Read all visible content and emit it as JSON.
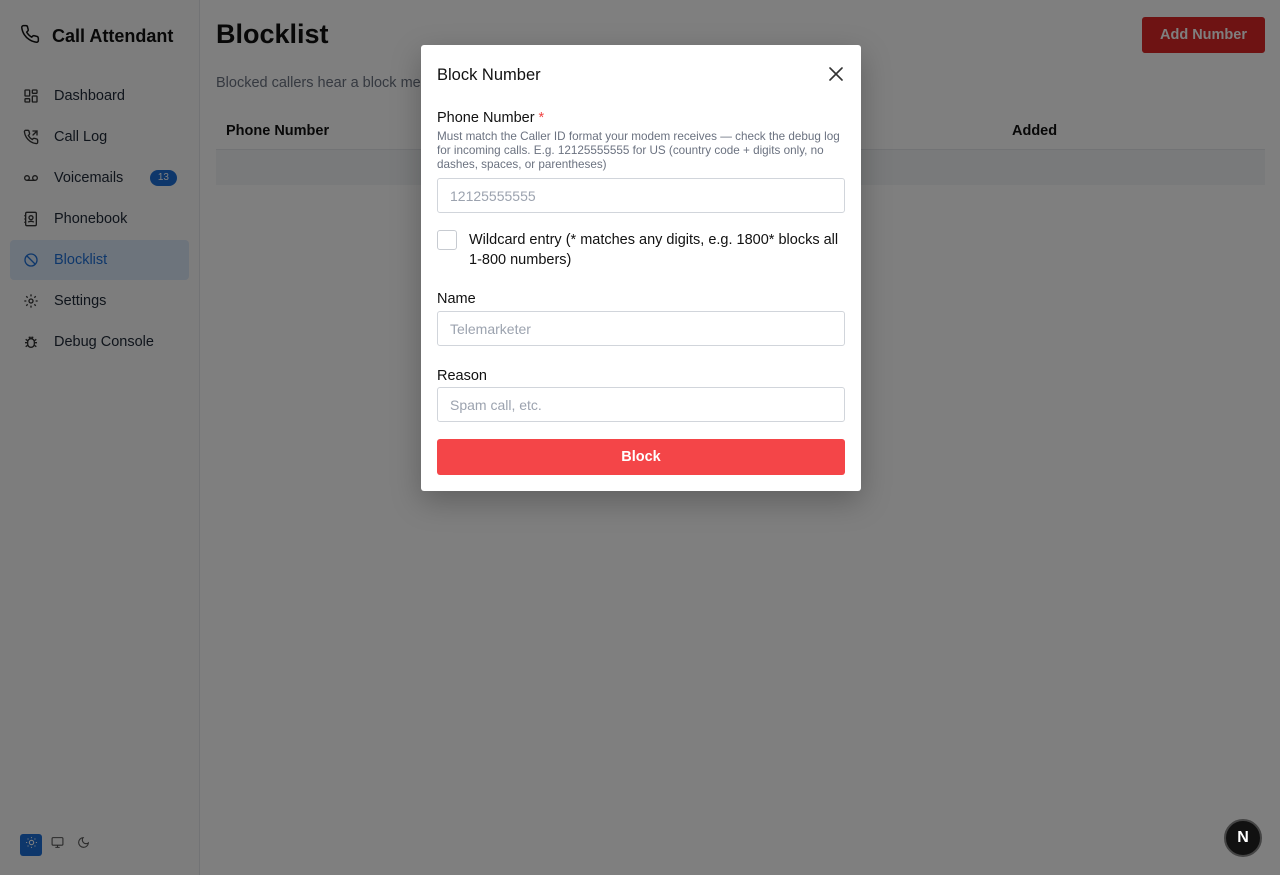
{
  "app": {
    "title": "Call Attendant"
  },
  "sidebar": {
    "items": [
      {
        "label": "Dashboard",
        "icon": "dashboard-icon"
      },
      {
        "label": "Call Log",
        "icon": "phone-log-icon"
      },
      {
        "label": "Voicemails",
        "icon": "voicemail-icon",
        "badge": "13"
      },
      {
        "label": "Phonebook",
        "icon": "contact-book-icon"
      },
      {
        "label": "Blocklist",
        "icon": "block-icon",
        "active": true
      },
      {
        "label": "Settings",
        "icon": "gear-icon"
      },
      {
        "label": "Debug Console",
        "icon": "bug-icon"
      }
    ],
    "theme_options": [
      "light",
      "system",
      "dark"
    ],
    "theme_selected": "light"
  },
  "page": {
    "title": "Blocklist",
    "add_button": "Add Number",
    "subtitle": "Blocked callers hear a block me",
    "table": {
      "columns": [
        "Phone Number",
        "Added"
      ]
    }
  },
  "modal": {
    "title": "Block Number",
    "phone": {
      "label": "Phone Number",
      "required_mark": "*",
      "help": "Must match the Caller ID format your modem receives — check the debug log for incoming calls. E.g. 12125555555 for US (country code + digits only, no dashes, spaces, or parentheses)",
      "placeholder": "12125555555",
      "value": ""
    },
    "wildcard": {
      "label": "Wildcard entry (* matches any digits, e.g. 1800* blocks all 1-800 numbers)",
      "checked": false
    },
    "name": {
      "label": "Name",
      "placeholder": "Telemarketer",
      "value": ""
    },
    "reason": {
      "label": "Reason",
      "placeholder": "Spam call, etc.",
      "value": ""
    },
    "submit": "Block"
  },
  "dev_badge": "N",
  "colors": {
    "accent": "#1d6fd6",
    "danger": "#dc2626",
    "submit": "#f44548"
  }
}
